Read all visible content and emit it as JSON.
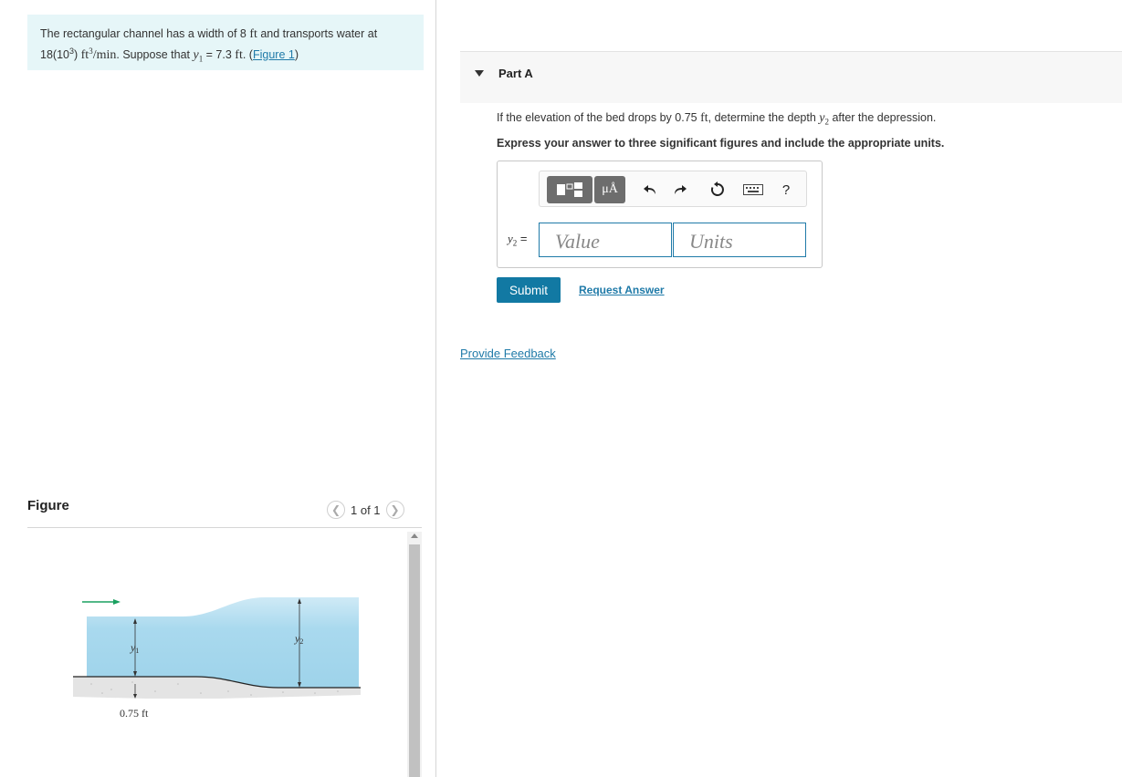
{
  "problem": {
    "text1": "The rectangular channel has a width of 8 ",
    "unit_ft": "ft",
    "text2": " and transports water at",
    "text3": "18(10",
    "exp3": "3",
    "text4": ") ",
    "flow_unit": "ft",
    "flow_exp": "3",
    "flow_per": "/min",
    "text5": ". Suppose that ",
    "y1_var": "y",
    "y1_sub": "1",
    "text6": " = 7.3 ",
    "unit_ft2": "ft",
    "text7": ". (",
    "figure_link": "Figure 1",
    "text8": ")"
  },
  "figure": {
    "title": "Figure",
    "pager": "1 of 1",
    "prev_icon": "chevron-left-icon",
    "next_icon": "chevron-right-icon",
    "labels": {
      "y1": "y",
      "y1_sub": "1",
      "y2": "y",
      "y2_sub": "2",
      "drop": "0.75 ft"
    },
    "colors": {
      "water": "#a9d9ee",
      "water_top": "#d4eef8",
      "ground": "#e6e6e6",
      "arrow": "#1aa060"
    }
  },
  "part": {
    "title": "Part A",
    "caret_icon": "caret-down-icon",
    "question_pre": "If the elevation of the bed drops by 0.75 ",
    "question_unit": "ft",
    "question_mid": ", determine the depth ",
    "question_var": "y",
    "question_sub": "2",
    "question_post": " after the depression.",
    "instruction": "Express your answer to three significant figures and include the appropriate units."
  },
  "answer": {
    "var": "y",
    "var_sub": "2",
    "equals": " =",
    "value_placeholder": "Value",
    "units_placeholder": "Units",
    "symbols_label": "μÅ",
    "help_label": "?",
    "undo_icon": "undo-icon",
    "redo_icon": "redo-icon",
    "reset_icon": "reset-icon",
    "keyboard_icon": "keyboard-icon"
  },
  "actions": {
    "submit": "Submit",
    "request_answer": "Request Answer",
    "provide_feedback": "Provide Feedback"
  },
  "colors": {
    "accent": "#1279a3",
    "link": "#1f7aa8",
    "problem_bg": "#e6f6f8"
  }
}
